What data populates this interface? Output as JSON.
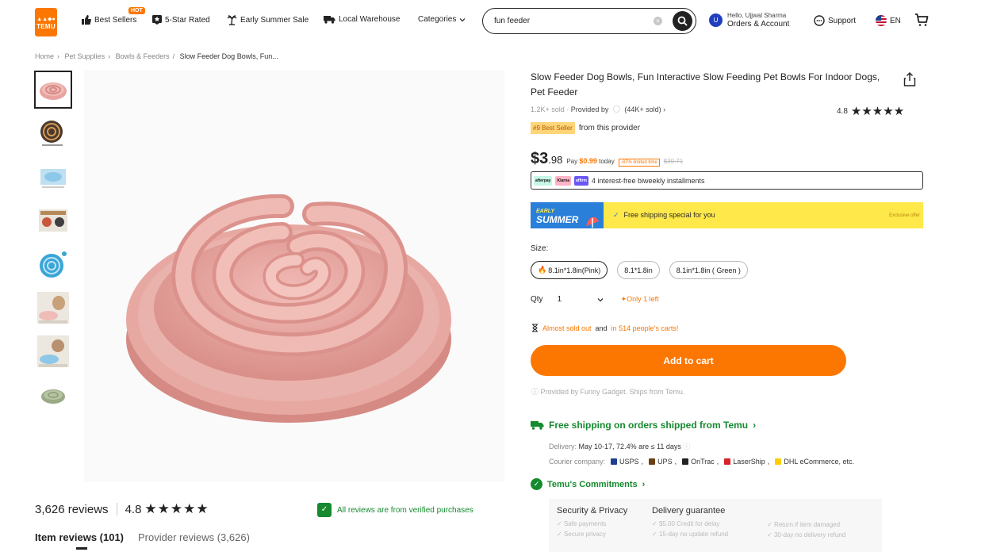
{
  "header": {
    "logo_line1": "▲▲◆●",
    "logo_line2": "TEMU",
    "nav": [
      {
        "label": "Best Sellers",
        "icon": "thumbs-up-icon"
      },
      {
        "label": "5-Star Rated",
        "icon": "star-badge-icon"
      },
      {
        "label": "Early Summer Sale",
        "icon": "palm-tree-icon"
      },
      {
        "label": "Local Warehouse",
        "icon": "truck-icon"
      },
      {
        "label": "Categories",
        "icon": "chevron-down-icon"
      }
    ],
    "hot_badge": "HOT",
    "search": {
      "value": "fun feeder",
      "clear_icon": "clear-icon",
      "button_icon": "search-icon"
    },
    "account": {
      "avatar": "U",
      "line1": "Hello, Ujjwal Sharma",
      "line2": "Orders & Account"
    },
    "support_label": "Support",
    "lang_label": "EN",
    "colors": {
      "brand": "#fb7701",
      "green": "#168a2e"
    }
  },
  "breadcrumb": [
    "Home",
    "Pet Supplies",
    "Bowls & Feeders",
    "Slow Feeder Dog Bowls, Fun..."
  ],
  "reviews": {
    "count_label": "3,626 reviews",
    "rating": "4.8",
    "stars": "★★★★★",
    "verified_label": "All reviews are from verified purchases",
    "tab_item": "Item reviews (101)",
    "tab_provider": "Provider reviews (3,626)"
  },
  "product": {
    "title": "Slow Feeder Dog Bowls, Fun Interactive Slow Feeding Pet Bowls For Indoor Dogs, Pet Feeder",
    "sold": "1.2K+ sold",
    "provided_by": "Provided by",
    "provider_sold": "(44K+ sold)",
    "rating": "4.8",
    "stars": "★★★★★",
    "best_seller_tag": "#9 Best Seller",
    "best_seller_text": "from this provider",
    "price_currency": "$",
    "price_int": "3",
    "price_dec": ".98",
    "pay_prefix": "Pay",
    "pay_amount": "$0.99",
    "pay_suffix": "today",
    "discount_badge": "-87% limited time",
    "original_price": "$30.71",
    "installments_text": "4 interest-free biweekly installments",
    "installment_pills": [
      "afterpay",
      "Klarna",
      "affirm"
    ],
    "banner": {
      "line1": "EARLY",
      "line2": "SUMMER",
      "message": "Free shipping special for you",
      "exclusive": "Exclusive offer"
    },
    "size_label": "Size:",
    "sizes": [
      "8.1in*1.8in(Pink)",
      "8.1*1.8in",
      "8.1in*1.8in ( Green )"
    ],
    "qty_label": "Qty",
    "qty_value": "1",
    "qty_note": "Only 1 left",
    "almost_sold_out": "Almost sold out",
    "carts_and": "and",
    "carts_people": "in 514 people's carts!",
    "add_to_cart": "Add to cart",
    "provided_note": "Provided by Funny Gadget. Ships from Temu.",
    "free_shipping": "Free shipping on orders shipped from Temu",
    "delivery_label": "Delivery:",
    "delivery_value": "May 10-17, 72.4% are ≤ 11 days",
    "courier_label": "Courier company:",
    "couriers": [
      "USPS",
      "UPS",
      "OnTrac",
      "LaserShip",
      "DHL eCommerce, etc."
    ],
    "courier_colors": [
      "#1f3f8f",
      "#6b3f16",
      "#222222",
      "#d8232a",
      "#ffcc00"
    ],
    "commitments_title": "Temu's Commitments",
    "security_title": "Security & Privacy",
    "security_items": [
      "Safe payments",
      "Secure privacy"
    ],
    "delivery_title": "Delivery guarantee",
    "delivery_items": [
      "$5.00 Credit for delay",
      "15-day no update refund"
    ],
    "delivery_items2": [
      "Return if item damaged",
      "30-day no delivery refund"
    ]
  }
}
